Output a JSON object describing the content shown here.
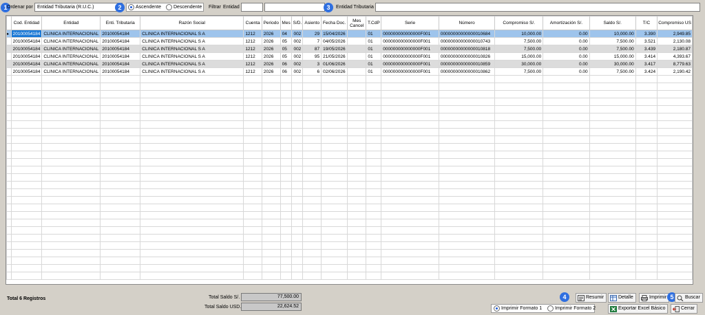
{
  "toolbar": {
    "order_label": "Ordenar por",
    "order_value": "Entidad Tributaria (R.U.C.)",
    "asc_label": "Ascendente",
    "desc_label": "Descendente",
    "filter_label": "Filtrar",
    "entity_label": "Entidad",
    "entity_tax_label": "Entidad Tributaria",
    "badges": [
      "1",
      "2",
      "3",
      "4",
      "5"
    ]
  },
  "grid": {
    "columns": [
      "Cod. Entidad",
      "Entidad",
      "Enti. Tributaria",
      "Razón Social",
      "Cuenta",
      "Periodo",
      "Mes",
      "S/D.",
      "Asiento",
      "Fecha Doc.",
      "Mes Cancel",
      "T.CdP",
      "Serie",
      "Número",
      "Compromiso S/.",
      "Amortización S/.",
      "Saldo S/.",
      "T/C",
      "Compromiso US"
    ],
    "rows": [
      [
        "20100054184",
        "CLINICA INTERNACIONAL",
        "20100054184",
        "CLINICA INTERNACIONAL S A",
        "1212",
        "2026",
        "04",
        "002",
        "29",
        "15/04/2026",
        "",
        "01",
        "000000000000000F001",
        "00000000000000010684",
        "10,000.00",
        "0.00",
        "10,000.00",
        "3.390",
        "2,949.85"
      ],
      [
        "20100054184",
        "CLINICA INTERNACIONAL",
        "20100054184",
        "CLINICA INTERNACIONAL S A",
        "1212",
        "2026",
        "05",
        "002",
        "7",
        "04/05/2026",
        "",
        "01",
        "000000000000000F001",
        "00000000000000010743",
        "7,500.00",
        "0.00",
        "7,500.00",
        "3.521",
        "2,130.08"
      ],
      [
        "20100054184",
        "CLINICA INTERNACIONAL",
        "20100054184",
        "CLINICA INTERNACIONAL S A",
        "1212",
        "2026",
        "05",
        "002",
        "87",
        "19/05/2026",
        "",
        "01",
        "000000000000000F001",
        "00000000000000010818",
        "7,500.00",
        "0.00",
        "7,500.00",
        "3.439",
        "2,180.87"
      ],
      [
        "20100054184",
        "CLINICA INTERNACIONAL",
        "20100054184",
        "CLINICA INTERNACIONAL S A",
        "1212",
        "2026",
        "05",
        "002",
        "95",
        "21/05/2026",
        "",
        "01",
        "000000000000000F001",
        "00000000000000010826",
        "15,000.00",
        "0.00",
        "15,000.00",
        "3.414",
        "4,393.67"
      ],
      [
        "20100054184",
        "CLINICA INTERNACIONAL",
        "20100054184",
        "CLINICA INTERNACIONAL S A",
        "1212",
        "2026",
        "06",
        "002",
        "3",
        "01/06/2026",
        "",
        "01",
        "000000000000000F001",
        "00000000000000010859",
        "30,000.00",
        "0.00",
        "30,000.00",
        "3.417",
        "8,779.63"
      ],
      [
        "20100054184",
        "CLINICA INTERNACIONAL",
        "20100054184",
        "CLINICA INTERNACIONAL S A",
        "1212",
        "2026",
        "06",
        "002",
        "6",
        "02/06/2026",
        "",
        "01",
        "000000000000000F001",
        "00000000000000010862",
        "7,500.00",
        "0.00",
        "7,500.00",
        "3.424",
        "2,190.42"
      ]
    ]
  },
  "footer": {
    "total_records": "Total 6 Registros",
    "total_pen_label": "Total Saldo S/.",
    "total_pen_value": "77,500.00",
    "total_usd_label": "Total Saldo USD.",
    "total_usd_value": "22,624.52",
    "resumir": "Resumir",
    "detalle": "Detalle",
    "imprimir": "Imprimir",
    "buscar": "Buscar",
    "format1": "Imprimir Formato 1",
    "format2": "Imprimir Formato 2",
    "excel": "Exportar Excel Básico",
    "cerrar": "Cerrar"
  }
}
